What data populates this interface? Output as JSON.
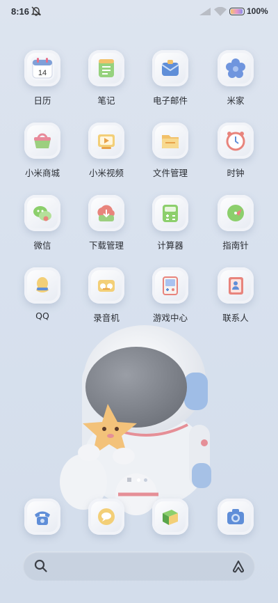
{
  "status": {
    "time": "8:16",
    "battery": "100%"
  },
  "apps": [
    {
      "label": "日历",
      "icon": "calendar-icon",
      "badge": "14"
    },
    {
      "label": "笔记",
      "icon": "notes-icon"
    },
    {
      "label": "电子邮件",
      "icon": "email-icon"
    },
    {
      "label": "米家",
      "icon": "mijia-icon"
    },
    {
      "label": "小米商城",
      "icon": "mi-store-icon"
    },
    {
      "label": "小米视频",
      "icon": "mi-video-icon"
    },
    {
      "label": "文件管理",
      "icon": "file-manager-icon"
    },
    {
      "label": "时钟",
      "icon": "clock-icon"
    },
    {
      "label": "微信",
      "icon": "wechat-icon"
    },
    {
      "label": "下载管理",
      "icon": "downloads-icon"
    },
    {
      "label": "计算器",
      "icon": "calculator-icon"
    },
    {
      "label": "指南针",
      "icon": "compass-icon"
    },
    {
      "label": "QQ",
      "icon": "qq-icon"
    },
    {
      "label": "录音机",
      "icon": "recorder-icon"
    },
    {
      "label": "游戏中心",
      "icon": "game-center-icon"
    },
    {
      "label": "联系人",
      "icon": "contacts-icon"
    }
  ],
  "dock": [
    {
      "icon": "phone-icon"
    },
    {
      "icon": "messages-icon"
    },
    {
      "icon": "app-store-icon"
    },
    {
      "icon": "camera-icon"
    }
  ],
  "colors": {
    "accent": "#4f7fd8",
    "background": "#dbe3ee"
  }
}
